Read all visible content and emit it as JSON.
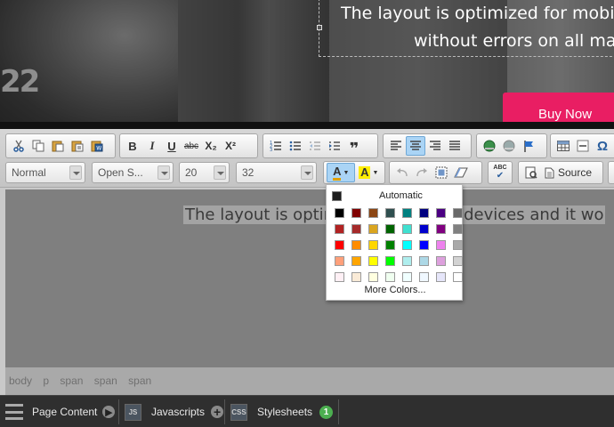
{
  "hero": {
    "badge_text": "22",
    "line1": "The layout is optimized for mobil",
    "line2": "without errors on all ma",
    "buy_button": "Buy Now"
  },
  "toolbar": {
    "icons_row1": [
      "cut-icon",
      "copy-icon",
      "paste-icon",
      "paste-text-icon",
      "paste-word-icon",
      "bold-icon",
      "italic-icon",
      "underline-icon",
      "strikethrough-icon",
      "subscript-icon",
      "superscript-icon",
      "numbered-list-icon",
      "bulleted-list-icon",
      "outdent-icon",
      "indent-icon",
      "blockquote-icon",
      "align-left-icon",
      "align-center-icon",
      "align-right-icon",
      "justify-icon",
      "link-icon",
      "unlink-icon",
      "anchor-icon",
      "table-icon",
      "horizontal-rule-icon",
      "special-char-icon"
    ],
    "bold": "B",
    "italic": "I",
    "underline": "U",
    "strike": "abc",
    "subscript": "X₂",
    "superscript": "X²",
    "format_combo": "Normal",
    "font_combo": "Open S...",
    "size_combo": "20",
    "lineheight_combo": "32",
    "text_color": "A",
    "bg_color": "A",
    "source_label": "Source",
    "spellcheck": "ABC"
  },
  "content": {
    "text": "The layout is optimized for mobile devices and it wo"
  },
  "path": [
    "body",
    "p",
    "span",
    "span",
    "span"
  ],
  "bottom": {
    "page_content": "Page Content",
    "js_tag": "JS",
    "javascripts": "Javascripts",
    "css_tag": "CSS",
    "stylesheets": "Stylesheets",
    "stylesheets_count": "1"
  },
  "color_panel": {
    "automatic": "Automatic",
    "more_colors": "More Colors...",
    "swatches": [
      "#000000",
      "#800000",
      "#8b4513",
      "#2f4f4f",
      "#008080",
      "#000080",
      "#4b0082",
      "#696969",
      "#b22222",
      "#a52a2a",
      "#daa520",
      "#006400",
      "#40e0d0",
      "#0000cd",
      "#800080",
      "#808080",
      "#ff0000",
      "#ff8c00",
      "#ffd700",
      "#008000",
      "#00ffff",
      "#0000ff",
      "#ee82ee",
      "#a9a9a9",
      "#ffa07a",
      "#ffa500",
      "#ffff00",
      "#00ff00",
      "#afeeee",
      "#add8e6",
      "#dda0dd",
      "#d3d3d3",
      "#fff0f5",
      "#faebd7",
      "#ffffe0",
      "#f0fff0",
      "#f0ffff",
      "#f0f8ff",
      "#e6e6fa",
      "#ffffff"
    ]
  }
}
